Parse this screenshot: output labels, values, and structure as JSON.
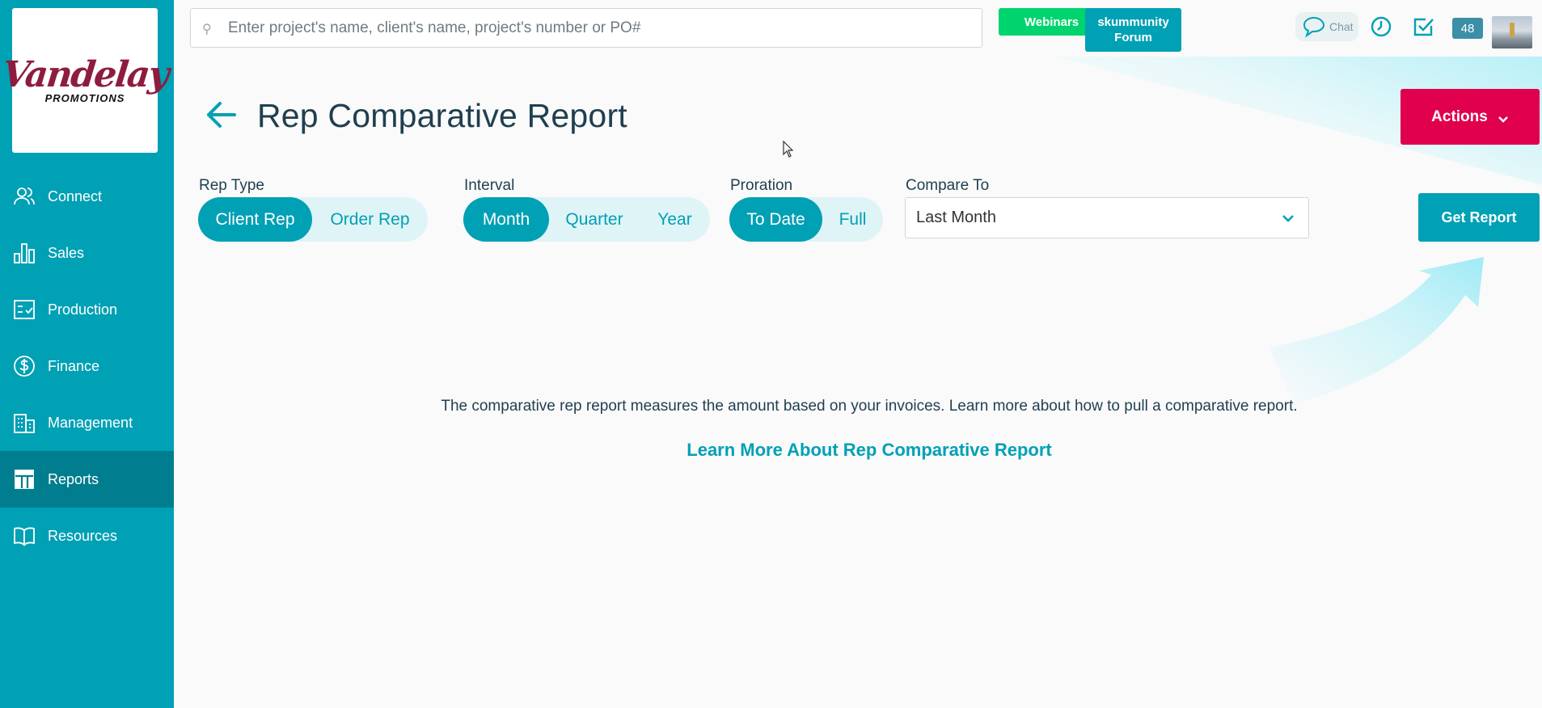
{
  "brand": {
    "name": "Vandelay",
    "tagline": "PROMOTIONS"
  },
  "sidebar": {
    "items": [
      {
        "label": "Connect",
        "icon": "users-icon",
        "active": false
      },
      {
        "label": "Sales",
        "icon": "bar-chart-icon",
        "active": false
      },
      {
        "label": "Production",
        "icon": "checklist-icon",
        "active": false
      },
      {
        "label": "Finance",
        "icon": "dollar-icon",
        "active": false
      },
      {
        "label": "Management",
        "icon": "building-icon",
        "active": false
      },
      {
        "label": "Reports",
        "icon": "table-icon",
        "active": true
      },
      {
        "label": "Resources",
        "icon": "book-icon",
        "active": false
      }
    ]
  },
  "topbar": {
    "search_placeholder": "Enter project's name, client's name, project's number or PO#",
    "webinars_label": "Webinars",
    "forum_label": "skummunity Forum",
    "chat_label": "Chat",
    "notification_count": "48"
  },
  "header": {
    "title": "Rep Comparative Report",
    "actions_label": "Actions"
  },
  "filters": {
    "rep_type": {
      "label": "Rep Type",
      "options": [
        "Client Rep",
        "Order Rep"
      ],
      "selected": "Client Rep"
    },
    "interval": {
      "label": "Interval",
      "options": [
        "Month",
        "Quarter",
        "Year"
      ],
      "selected": "Month"
    },
    "proration": {
      "label": "Proration",
      "options": [
        "To Date",
        "Full"
      ],
      "selected": "To Date"
    },
    "compare_to": {
      "label": "Compare To",
      "value": "Last Month"
    },
    "get_report_label": "Get Report"
  },
  "info": {
    "description": "The comparative rep report measures the amount based on your invoices. Learn more about how to pull a comparative report.",
    "link_label": "Learn More About Rep Comparative Report"
  },
  "colors": {
    "primary": "#00a0b5",
    "primary_dark": "#007d8e",
    "accent_green": "#00d46e",
    "accent_red": "#e0004d",
    "brand_maroon": "#8e1c3e"
  }
}
